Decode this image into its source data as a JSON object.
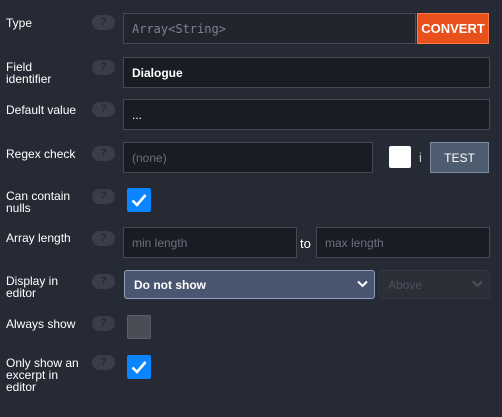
{
  "rows": {
    "type": {
      "label": "Type",
      "value": "Array<String>",
      "button": "CONVERT"
    },
    "field_identifier": {
      "label_line1": "Field",
      "label_line2": "identifier",
      "value": "Dialogue"
    },
    "default_value": {
      "label": "Default value",
      "value": "..."
    },
    "regex_check": {
      "label": "Regex check",
      "placeholder": "(none)",
      "info": "i",
      "button": "TEST"
    },
    "can_contain_nulls": {
      "label_line1": "Can contain",
      "label_line2": "nulls",
      "checked": true
    },
    "array_length": {
      "label": "Array length",
      "min_placeholder": "min length",
      "separator": "to",
      "max_placeholder": "max length"
    },
    "display_in_editor": {
      "label_line1": "Display in",
      "label_line2": "editor",
      "selected": "Do not show",
      "position_selected": "Above"
    },
    "always_show": {
      "label": "Always show",
      "checked": false
    },
    "excerpt": {
      "label_line1": "Only show an",
      "label_line2": "excerpt in",
      "label_line3": "editor",
      "checked": true
    }
  },
  "help_glyph": "?",
  "colors": {
    "background": "#262a34",
    "input_bg": "#1a1c23",
    "accent_orange": "#e8501c",
    "checkbox_blue": "#0a84ff",
    "select_bg": "#4a5670"
  },
  "icons": [
    "help-icon",
    "checkmark-icon",
    "chevron-down-icon"
  ]
}
